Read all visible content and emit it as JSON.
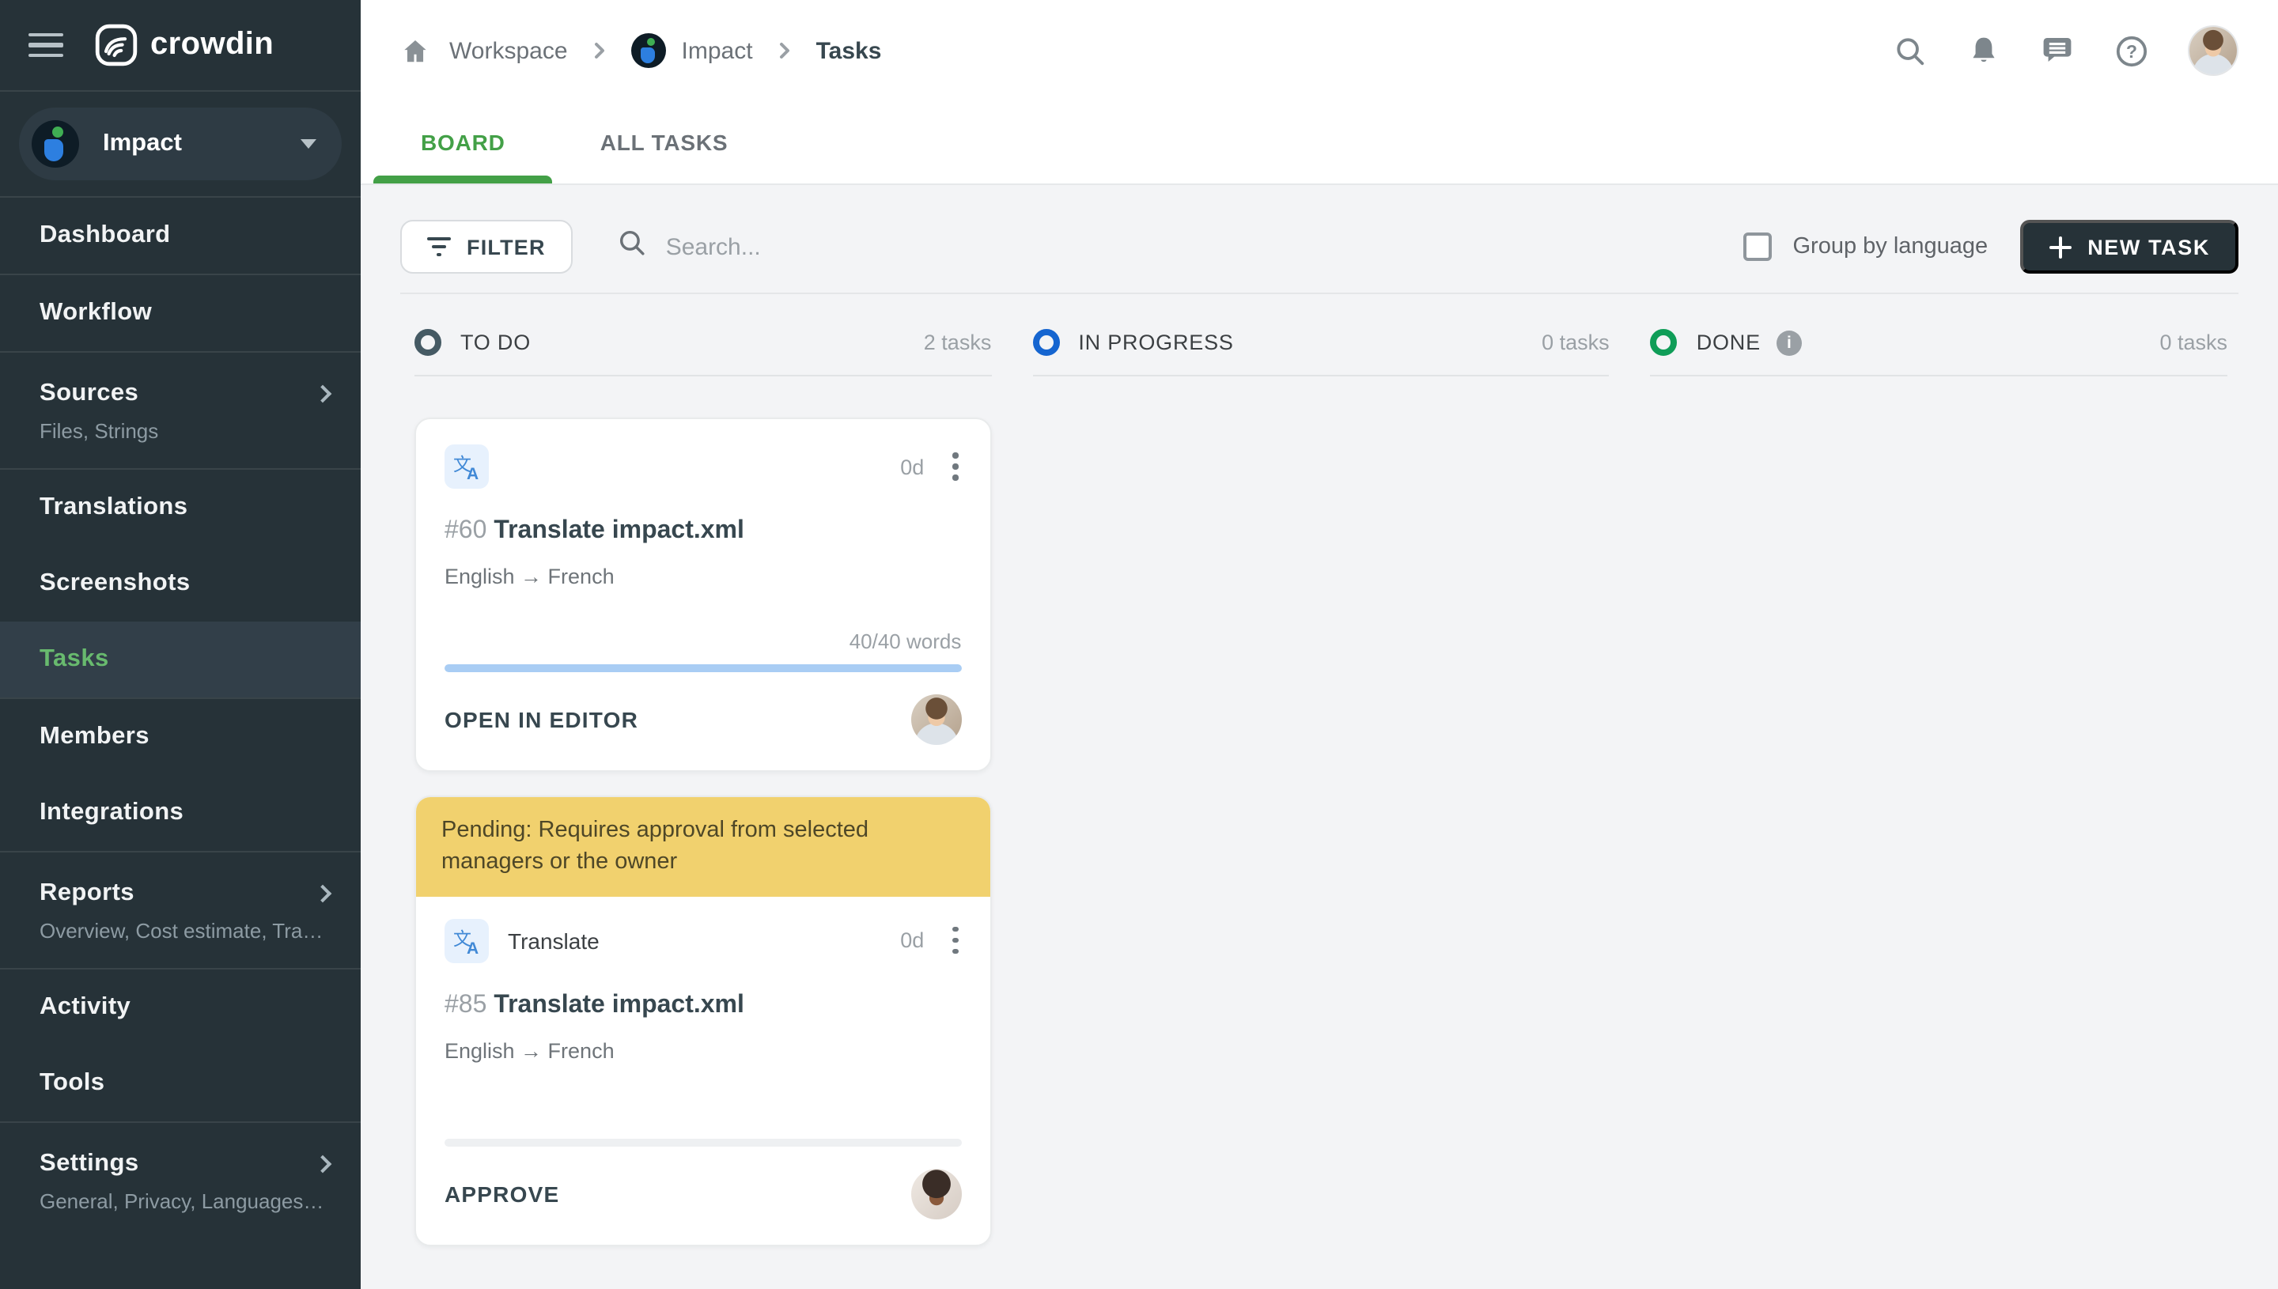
{
  "sidebar": {
    "logo_text": "crowdin",
    "project": {
      "name": "Impact"
    },
    "items": [
      {
        "label": "Dashboard"
      },
      {
        "label": "Workflow"
      },
      {
        "label": "Sources",
        "sub": "Files, Strings"
      },
      {
        "label": "Translations"
      },
      {
        "label": "Screenshots"
      },
      {
        "label": "Tasks",
        "active": true
      },
      {
        "label": "Members"
      },
      {
        "label": "Integrations"
      },
      {
        "label": "Reports",
        "sub": "Overview, Cost estimate, Transl..."
      },
      {
        "label": "Activity"
      },
      {
        "label": "Tools"
      },
      {
        "label": "Settings",
        "sub": "General, Privacy, Languages, Q..."
      }
    ]
  },
  "header": {
    "breadcrumb": {
      "workspace": "Workspace",
      "project": "Impact",
      "current": "Tasks"
    },
    "tabs": [
      {
        "label": "BOARD",
        "active": true
      },
      {
        "label": "ALL TASKS",
        "active": false
      }
    ]
  },
  "toolbar": {
    "filter_label": "FILTER",
    "search_placeholder": "Search...",
    "group_by_label": "Group by language",
    "new_task_label": "NEW TASK"
  },
  "board": {
    "columns": [
      {
        "name": "TO DO",
        "count_label": "2 tasks",
        "color": "#455a64",
        "has_info": false
      },
      {
        "name": "IN PROGRESS",
        "count_label": "0 tasks",
        "color": "#1565d0",
        "has_info": false
      },
      {
        "name": "DONE",
        "count_label": "0 tasks",
        "color": "#0f9d58",
        "has_info": true
      }
    ],
    "cards": [
      {
        "id_label": "#60",
        "title": "Translate impact.xml",
        "due": "0d",
        "languages": "English → French",
        "words": "40/40 words",
        "progress_percent": 100,
        "action": "OPEN IN EDITOR"
      },
      {
        "banner": "Pending: Requires approval from selected managers or the owner",
        "type_label": "Translate",
        "id_label": "#85",
        "title": "Translate impact.xml",
        "due": "0d",
        "languages": "English → French",
        "words": "",
        "progress_percent": 0,
        "action": "APPROVE"
      }
    ]
  },
  "colors": {
    "sidebar_bg": "#263238",
    "sidebar_active_text": "#68ba6e",
    "accent_green": "#43a047",
    "todo_circle": "#455a64",
    "in_progress_circle": "#1565d0",
    "done_circle": "#0f9d58",
    "banner_bg": "#f1d16e",
    "progress_fill": "#a9cdf4",
    "new_task_button_bg": "#263238"
  }
}
